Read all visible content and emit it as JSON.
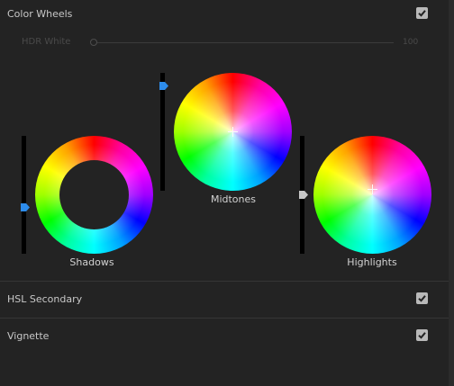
{
  "sections": {
    "color_wheels": {
      "title": "Color Wheels",
      "enabled": true
    },
    "hsl_secondary": {
      "title": "HSL Secondary",
      "enabled": true
    },
    "vignette": {
      "title": "Vignette",
      "enabled": true
    }
  },
  "hdr_white": {
    "label": "HDR White",
    "value": "100",
    "slider_fraction": 0.0,
    "disabled": true
  },
  "wheels": {
    "shadows": {
      "label": "Shadows",
      "slider_color": "#2d8ceb"
    },
    "midtones": {
      "label": "Midtones",
      "slider_color": "#2d8ceb"
    },
    "highlights": {
      "label": "Highlights",
      "slider_color": "#c8c8c8"
    }
  },
  "colors": {
    "panel_bg": "#232323",
    "accent": "#2d8ceb",
    "checkbox": "#b9b9b9"
  }
}
